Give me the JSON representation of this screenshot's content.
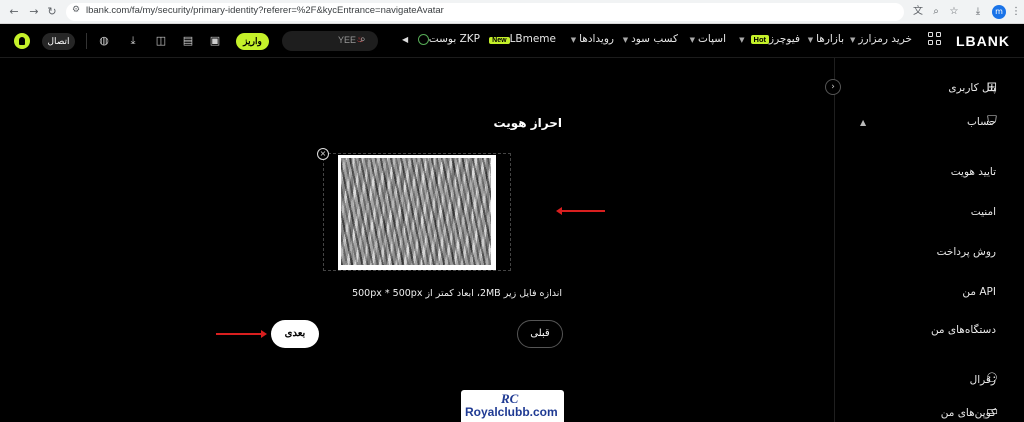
{
  "browser": {
    "url": "lbank.com/fa/my/security/primary-identity?referer=%2F&kycEntrance=navigateAvatar",
    "profile_initial": "m"
  },
  "topnav": {
    "logo": "LBANK",
    "items": {
      "buy_crypto": "خرید رمزارز",
      "markets": "بازارها",
      "futures": "فیوچرز",
      "futures_badge": "Hot",
      "spot": "اسپات",
      "earn": "کسب سود",
      "events": "رویدادها",
      "lbmeme": "LBmeme",
      "lbmeme_badge": "New",
      "zkp": "ZKP بوست"
    },
    "search": {
      "text": "YEE"
    },
    "deposit_label": "واریز",
    "connect_label": "اتصال"
  },
  "sidebar": {
    "panel": "پنل کاربری",
    "account": "حساب",
    "verify": "تایید هویت",
    "security": "امنیت",
    "payment": "روش پرداخت",
    "api": "API من",
    "devices": "دستگاه‌های من",
    "referral": "رفرال",
    "coupons": "کوپن‌های من"
  },
  "main": {
    "title": "احراز هویت",
    "size_hint": "اندازه فایل زیر 2MB، ابعاد کمتر از 500px * 500px",
    "prev_label": "قبلی",
    "next_label": "بعدی"
  },
  "watermark": {
    "logo": "RC",
    "text": "Royalclubb.com"
  },
  "colors": {
    "accent": "#c5f12a",
    "annotation_arrow": "#d91f1f",
    "watermark_text": "#1f3a93"
  }
}
